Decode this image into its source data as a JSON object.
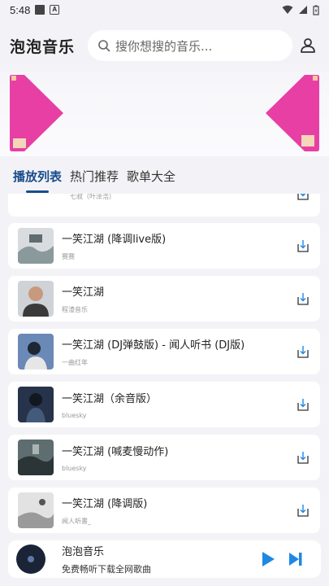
{
  "status": {
    "time": "5:48"
  },
  "header": {
    "title": "泡泡音乐",
    "search_placeholder": "搜你想搜的音乐..."
  },
  "tabs": [
    {
      "label": "播放列表",
      "active": true
    },
    {
      "label": "热门推荐",
      "active": false
    },
    {
      "label": "歌单大全",
      "active": false
    }
  ],
  "songs": [
    {
      "title": "",
      "artist": "七叔（叶泽浩）",
      "cover_color": "#c9ccd2"
    },
    {
      "title": "一笑江湖 (降调live版)",
      "artist": "赛赛",
      "cover_color": "#b8c2c4"
    },
    {
      "title": "一笑江湖",
      "artist": "程渣音乐",
      "cover_color": "#5b5a58"
    },
    {
      "title": "一笑江湖 (DJ弹鼓版) - 闻人听书 (DJ版)",
      "artist": "一曲红年",
      "cover_color": "#4a6a95"
    },
    {
      "title": "一笑江湖（余音版）",
      "artist": "bluesky",
      "cover_color": "#2a3448"
    },
    {
      "title": "一笑江湖 (喊麦慢动作)",
      "artist": "bluesky",
      "cover_color": "#3d4b4e"
    },
    {
      "title": "一笑江湖 (降调版)",
      "artist": "闻人听書_",
      "cover_color": "#d6d6d6"
    }
  ],
  "player": {
    "title": "泡泡音乐",
    "subtitle": "免费畅听下载全网歌曲"
  },
  "colors": {
    "accent": "#1a4d8c",
    "play": "#1e88e5",
    "banner": "#e83fa4"
  },
  "icons": {
    "search": "search-icon",
    "user": "user-icon",
    "download": "download-icon",
    "play": "play-icon",
    "next": "next-icon"
  }
}
